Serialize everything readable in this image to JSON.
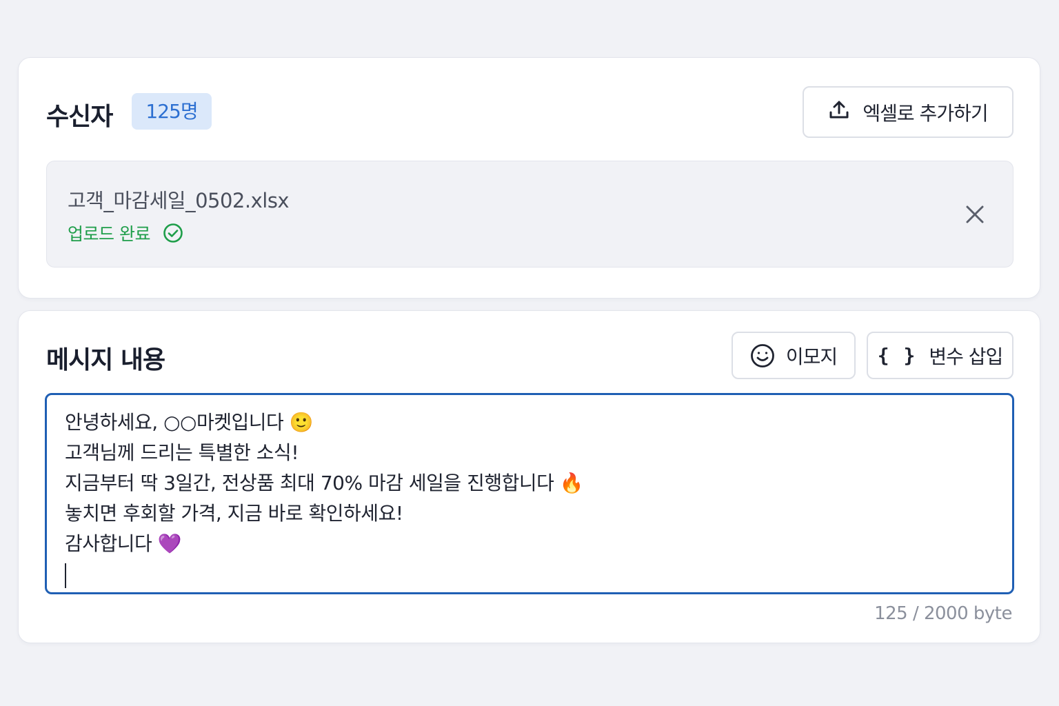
{
  "recipients": {
    "title": "수신자",
    "count_badge": "125명",
    "excel_button_label": "엑셀로 추가하기",
    "excel_button_icon": "upload-icon",
    "file": {
      "name": "고객_마감세일_0502.xlsx",
      "status": "업로드 완료",
      "status_icon": "check-circle-icon",
      "remove_icon": "close-icon"
    }
  },
  "message": {
    "title": "메시지 내용",
    "emoji_button_label": "이모지",
    "emoji_button_icon": "smiley-icon",
    "variable_button_label": "변수 삽입",
    "variable_button_icon_text": "{ }",
    "lines": [
      "안녕하세요, ○○마켓입니다 🙂",
      "고객님께 드리는 특별한 소식!",
      "지금부터 딱 3일간, 전상품 최대 70% 마감 세일을 진행합니다 🔥",
      "놓치면 후회할 가격, 지금 바로 확인하세요!",
      "감사합니다 💜"
    ],
    "byte_counter": "125 / 2000 byte"
  },
  "colors": {
    "accent": "#1f5fb4",
    "badge_bg": "#dbe8fa",
    "badge_text": "#2c6fd1",
    "success": "#1f9e4a",
    "background": "#f1f2f6"
  }
}
